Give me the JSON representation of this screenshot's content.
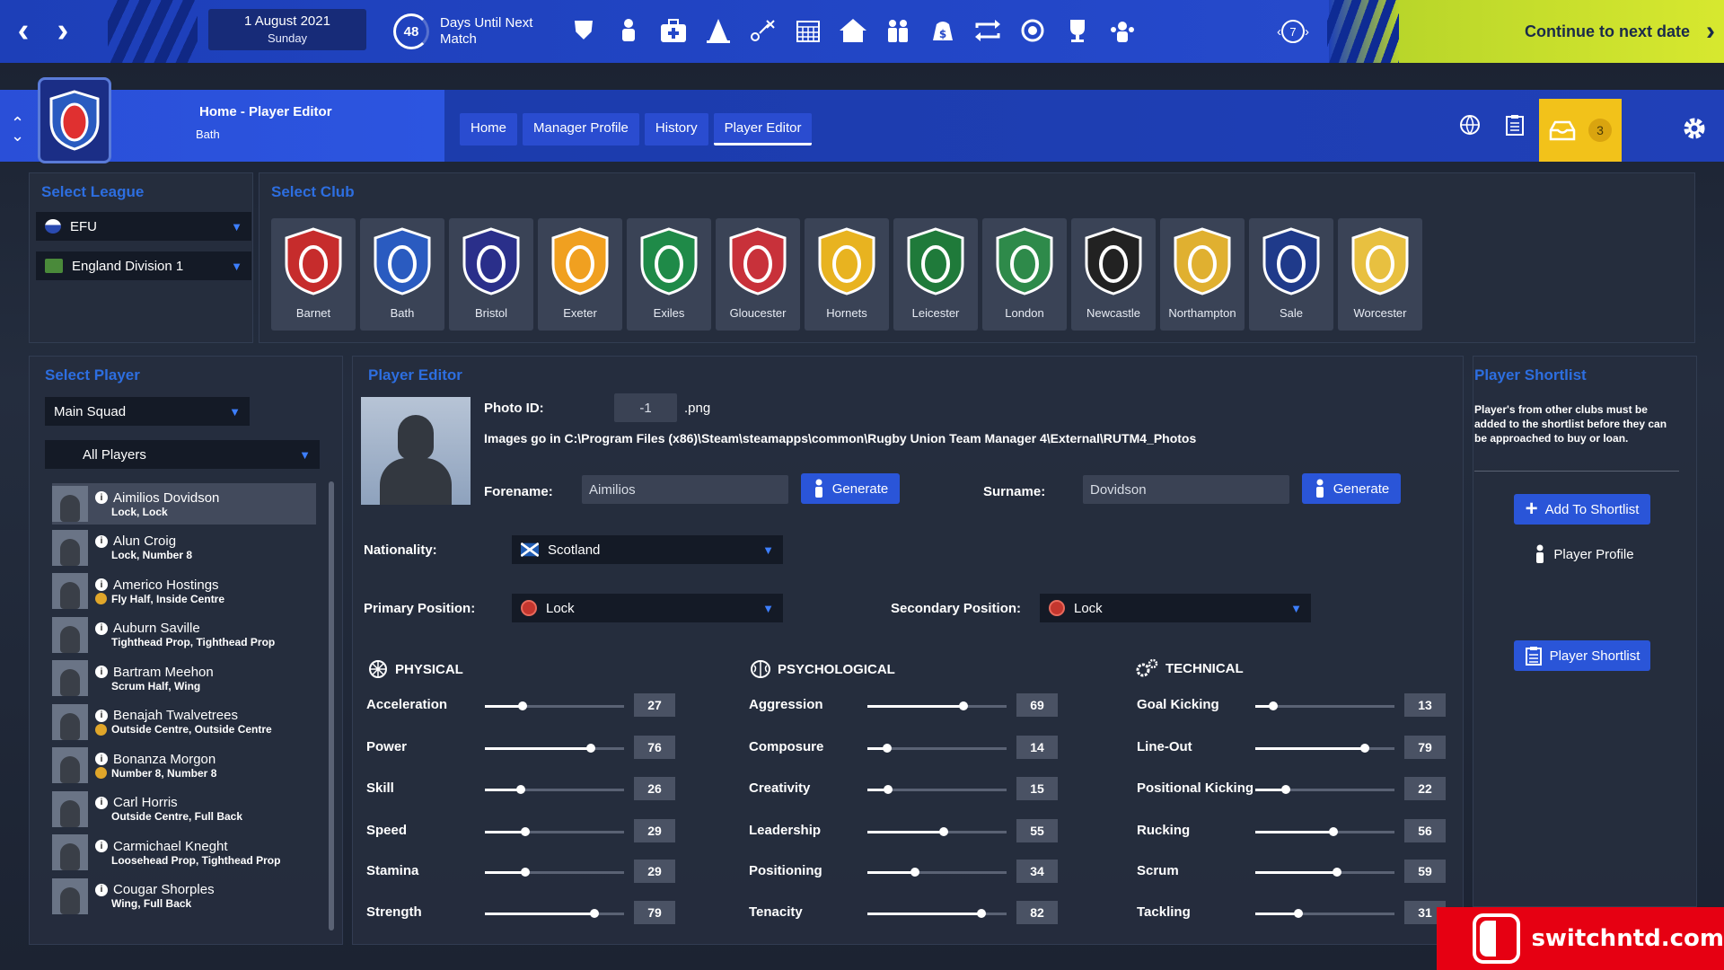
{
  "topbar": {
    "date_line1": "1 August 2021",
    "date_line2": "Sunday",
    "days_count": "48",
    "days_label_line1": "Days Until Next",
    "days_label_line2": "Match",
    "speed": "7",
    "continue_label": "Continue to next date",
    "icons": [
      "shield-icon",
      "kit-icon",
      "medical-icon",
      "training-cone-icon",
      "tactics-icon",
      "calendar-icon",
      "home-icon",
      "squad-icon",
      "finance-icon",
      "transfer-icon",
      "scouting-icon",
      "trophy-icon",
      "staff-icon"
    ]
  },
  "breadcrumb": {
    "title": "Home - Player Editor",
    "subtitle": "Bath"
  },
  "tabs": [
    "Home",
    "Manager Profile",
    "History",
    "Player Editor"
  ],
  "active_tab": "Player Editor",
  "inbox_count": "3",
  "select_league": {
    "title": "Select League",
    "federation": "EFU",
    "division": "England Division 1"
  },
  "select_club": {
    "title": "Select Club",
    "clubs": [
      {
        "name": "Barnet",
        "color": "#c62c2c"
      },
      {
        "name": "Bath",
        "color": "#2a5bc0"
      },
      {
        "name": "Bristol",
        "color": "#2a2f8a"
      },
      {
        "name": "Exeter",
        "color": "#f0a020"
      },
      {
        "name": "Exiles",
        "color": "#1f8a48"
      },
      {
        "name": "Gloucester",
        "color": "#c8313a"
      },
      {
        "name": "Hornets",
        "color": "#e8b320"
      },
      {
        "name": "Leicester",
        "color": "#1f7a3a"
      },
      {
        "name": "London",
        "color": "#2e8a4a"
      },
      {
        "name": "Newcastle",
        "color": "#222222"
      },
      {
        "name": "Northampton",
        "color": "#e0b030"
      },
      {
        "name": "Sale",
        "color": "#1f3a8a"
      },
      {
        "name": "Worcester",
        "color": "#e8c040"
      }
    ]
  },
  "select_player": {
    "title": "Select Player",
    "squad": "Main Squad",
    "filter": "All Players",
    "players": [
      {
        "name": "Aimilios Dovidson",
        "pos": "Lock, Lock",
        "star": false
      },
      {
        "name": "Alun Croig",
        "pos": "Lock, Number 8",
        "star": false
      },
      {
        "name": "Americo Hostings",
        "pos": "Fly Half, Inside Centre",
        "star": true
      },
      {
        "name": "Auburn Saville",
        "pos": "Tighthead Prop, Tighthead Prop",
        "star": false
      },
      {
        "name": "Bartram Meehon",
        "pos": "Scrum Half, Wing",
        "star": false
      },
      {
        "name": "Benajah Twalvetrees",
        "pos": "Outside Centre, Outside Centre",
        "star": true
      },
      {
        "name": "Bonanza Morgon",
        "pos": "Number 8, Number 8",
        "star": true
      },
      {
        "name": "Carl Horris",
        "pos": "Outside Centre, Full Back",
        "star": false
      },
      {
        "name": "Carmichael Kneght",
        "pos": "Loosehead Prop, Tighthead Prop",
        "star": false
      },
      {
        "name": "Cougar Shorples",
        "pos": "Wing, Full Back",
        "star": false
      }
    ]
  },
  "editor": {
    "title": "Player Editor",
    "photo_id_label": "Photo ID:",
    "photo_id_value": "-1",
    "photo_ext": ".png",
    "images_path": "Images go in C:\\Program Files (x86)\\Steam\\steamapps\\common\\Rugby Union Team Manager 4\\External\\RUTM4_Photos",
    "forename_label": "Forename:",
    "forename": "Aimilios",
    "surname_label": "Surname:",
    "surname": "Dovidson",
    "generate_label": "Generate",
    "nationality_label": "Nationality:",
    "nationality": "Scotland",
    "primary_label": "Primary Position:",
    "primary": "Lock",
    "secondary_label": "Secondary Position:",
    "secondary": "Lock",
    "physical_title": "PHYSICAL",
    "psychological_title": "PSYCHOLOGICAL",
    "technical_title": "TECHNICAL",
    "physical": [
      {
        "name": "Acceleration",
        "value": 27
      },
      {
        "name": "Power",
        "value": 76
      },
      {
        "name": "Skill",
        "value": 26
      },
      {
        "name": "Speed",
        "value": 29
      },
      {
        "name": "Stamina",
        "value": 29
      },
      {
        "name": "Strength",
        "value": 79
      }
    ],
    "psychological": [
      {
        "name": "Aggression",
        "value": 69
      },
      {
        "name": "Composure",
        "value": 14
      },
      {
        "name": "Creativity",
        "value": 15
      },
      {
        "name": "Leadership",
        "value": 55
      },
      {
        "name": "Positioning",
        "value": 34
      },
      {
        "name": "Tenacity",
        "value": 82
      }
    ],
    "technical": [
      {
        "name": "Goal Kicking",
        "value": 13
      },
      {
        "name": "Line-Out",
        "value": 79
      },
      {
        "name": "Positional Kicking",
        "value": 22
      },
      {
        "name": "Rucking",
        "value": 56
      },
      {
        "name": "Scrum",
        "value": 59
      },
      {
        "name": "Tackling",
        "value": 31
      }
    ],
    "attribute_max": 100
  },
  "shortlist": {
    "title": "Player Shortlist",
    "note": "Player's from other clubs must be added to the shortlist before they can be approached to buy or loan.",
    "add_label": "Add To Shortlist",
    "profile_label": "Player Profile",
    "shortlist_label": "Player Shortlist"
  },
  "watermark": "switchntd.com"
}
